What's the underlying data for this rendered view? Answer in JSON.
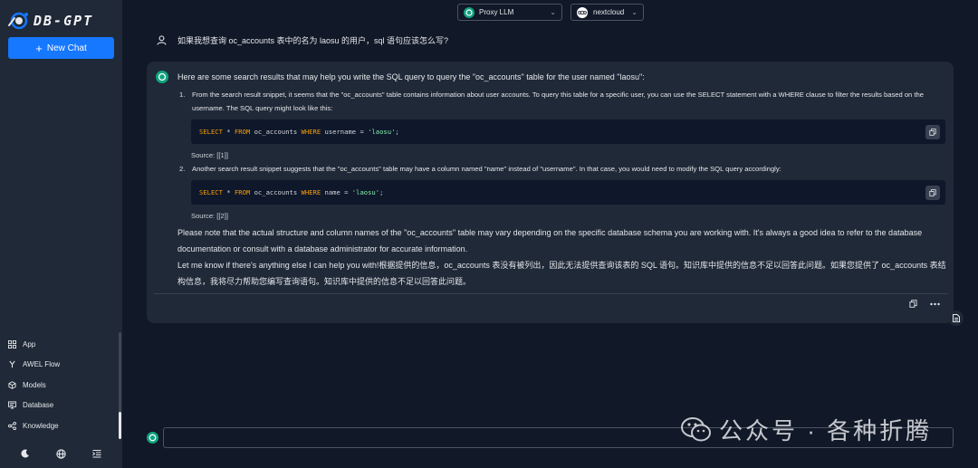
{
  "sidebar": {
    "logo_text": "DB-GPT",
    "new_chat_label": "New Chat",
    "nav": [
      {
        "label": "App",
        "icon": "app-grid-icon"
      },
      {
        "label": "AWEL Flow",
        "icon": "flow-branch-icon"
      },
      {
        "label": "Models",
        "icon": "model-cube-icon"
      },
      {
        "label": "Database",
        "icon": "database-monitor-icon"
      },
      {
        "label": "Knowledge",
        "icon": "knowledge-share-icon"
      }
    ],
    "bottom_icons": [
      "moon-icon",
      "globe-icon",
      "menu-fold-icon"
    ]
  },
  "header": {
    "model_select": "Proxy LLM",
    "db_select": "nextcloud"
  },
  "question": "如果我想查询 oc_accounts 表中的名为 laosu 的用户，sql 语句应该怎么写?",
  "answer": {
    "intro": "Here are some search results that may help you write the SQL query to query the \"oc_accounts\" table for the user named \"laosu\":",
    "items": [
      {
        "num": "1.",
        "text": "From the search result snippet, it seems that the \"oc_accounts\" table contains information about user accounts. To query this table for a specific user, you can use the SELECT statement with a WHERE clause to filter the results based on the username. The SQL query might look like this:",
        "code": {
          "kw1": "SELECT",
          "mid1": " * ",
          "kw2": "FROM",
          "mid2": " oc_accounts ",
          "kw3": "WHERE",
          "mid3": " username = ",
          "str": "'laosu'",
          "end": ";"
        },
        "source": "Source: [[1]]"
      },
      {
        "num": "2.",
        "text": "Another search result snippet suggests that the \"oc_accounts\" table may have a column named \"name\" instead of \"username\". In that case, you would need to modify the SQL query accordingly:",
        "code": {
          "kw1": "SELECT",
          "mid1": " * ",
          "kw2": "FROM",
          "mid2": " oc_accounts ",
          "kw3": "WHERE",
          "mid3": " name = ",
          "str": "'laosu'",
          "end": ";"
        },
        "source": "Source: [[2]]"
      }
    ],
    "note": "Please note that the actual structure and column names of the \"oc_accounts\" table may vary depending on the specific database schema you are working with. It's always a good idea to refer to the database documentation or consult with a database administrator for accurate information.",
    "closing": "Let me know if there's anything else I can help you with!根据提供的信息，oc_accounts 表没有被列出，因此无法提供查询该表的 SQL 语句。知识库中提供的信息不足以回答此问题。如果您提供了 oc_accounts 表结构信息，我将尽力帮助您编写查询语句。知识库中提供的信息不足以回答此问题。"
  },
  "input": {
    "value": ""
  },
  "watermark": "公众号 · 各种折腾",
  "colors": {
    "primary": "#1677ff",
    "background": "#111827",
    "panel": "#1f2937"
  }
}
